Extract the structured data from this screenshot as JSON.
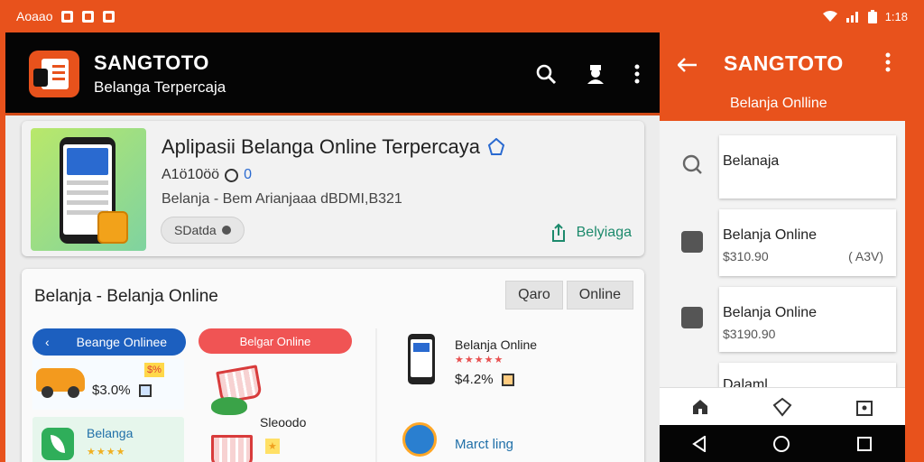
{
  "status_bar": {
    "left_text": "Aoaao",
    "right_text": "1:18"
  },
  "app": {
    "brand_name": "SANGTOTO",
    "brand_tagline": "Belanga Terpercaja"
  },
  "featured_card": {
    "title": "Aplipasii Belanga Online Terpercaya",
    "meta": "A1ö10öö",
    "meta_extra": "0",
    "description": "Belanja - Bem Arianjaaa dBDMI,B321",
    "pill_label": "SDatda",
    "share_label": "Belyiaga"
  },
  "section": {
    "title": "Belanja - Belanja Online",
    "buttons": [
      "Qaro",
      "Online"
    ],
    "col1": {
      "tab_label": "Beange Onlinee",
      "price": "$3.0%",
      "tag": "$%",
      "green_label": "Belanga",
      "stars": "★★★★"
    },
    "col2": {
      "tab_label": "Belgar Online",
      "sub_label": "Sleoodo"
    },
    "col3": {
      "title": "Belanja Online",
      "stars": "★★★★★",
      "price": "$4.2%",
      "bottom_label": "Marct ling"
    }
  },
  "right_app": {
    "title": "SANGTOTO",
    "subtitle": "Belanja Onlline",
    "items": [
      {
        "title": "Belanaja",
        "price": "",
        "extra": ""
      },
      {
        "title": "Belanja Online",
        "price": "$310.90",
        "extra": "( A3V)"
      },
      {
        "title": "Belanja Online",
        "price": "$3190.90",
        "extra": ""
      },
      {
        "title": "Dalaml",
        "price": "",
        "extra": ""
      }
    ]
  },
  "colors": {
    "accent": "#e8521c",
    "topbar": "#050505",
    "blue": "#1c5fbf",
    "green": "#1d8a6c"
  }
}
